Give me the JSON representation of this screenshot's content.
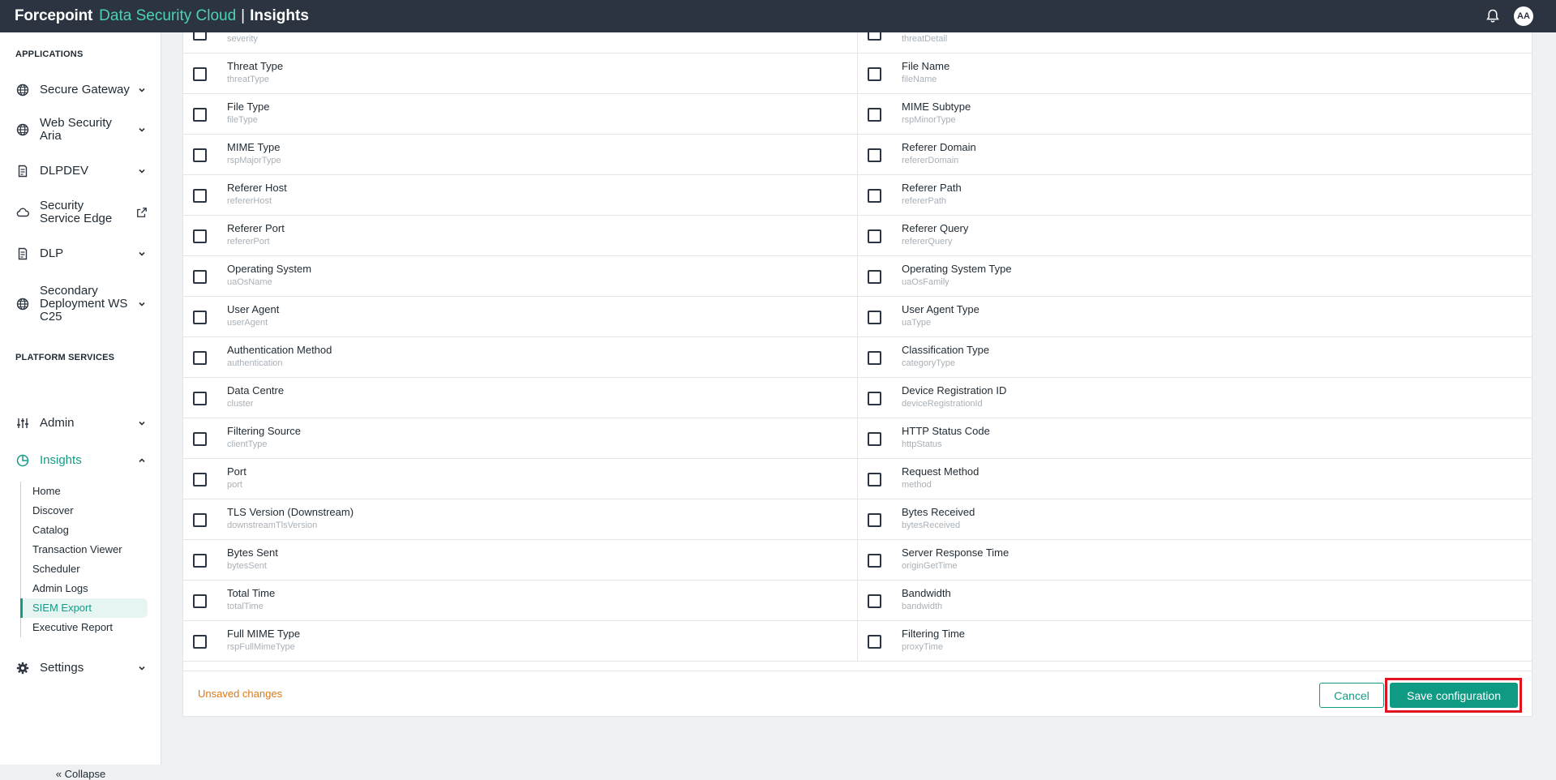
{
  "header": {
    "brand": "Forcepoint",
    "product": "Data Security Cloud",
    "separator": "|",
    "app": "Insights",
    "avatar_initials": "AA"
  },
  "sidebar": {
    "applications_heading": "APPLICATIONS",
    "applications": [
      {
        "label": "Secure Gateway",
        "icon": "globe-icon"
      },
      {
        "label": "Web Security Aria",
        "icon": "globe-icon"
      },
      {
        "label": "DLPDEV",
        "icon": "document-icon"
      },
      {
        "label": "Security Service Edge",
        "icon": "cloud-icon"
      },
      {
        "label": "DLP",
        "icon": "document-icon"
      },
      {
        "label": "Secondary Deployment WS C25",
        "icon": "globe-icon"
      }
    ],
    "platform_heading": "PLATFORM SERVICES",
    "admin_label": "Admin",
    "insights_label": "Insights",
    "insights_subitems": [
      "Home",
      "Discover",
      "Catalog",
      "Transaction Viewer",
      "Scheduler",
      "Admin Logs",
      "SIEM Export",
      "Executive Report"
    ],
    "active_subitem": "SIEM Export",
    "settings_label": "Settings",
    "collapse_label": "Collapse"
  },
  "fields": {
    "partial_row": {
      "left_key": "severity",
      "right_key": "threatDetail"
    },
    "rows": [
      {
        "left": {
          "label": "Threat Type",
          "key": "threatType"
        },
        "right": {
          "label": "File Name",
          "key": "fileName"
        }
      },
      {
        "left": {
          "label": "File Type",
          "key": "fileType"
        },
        "right": {
          "label": "MIME Subtype",
          "key": "rspMinorType"
        }
      },
      {
        "left": {
          "label": "MIME Type",
          "key": "rspMajorType"
        },
        "right": {
          "label": "Referer Domain",
          "key": "refererDomain"
        }
      },
      {
        "left": {
          "label": "Referer Host",
          "key": "refererHost"
        },
        "right": {
          "label": "Referer Path",
          "key": "refererPath"
        }
      },
      {
        "left": {
          "label": "Referer Port",
          "key": "refererPort"
        },
        "right": {
          "label": "Referer Query",
          "key": "refererQuery"
        }
      },
      {
        "left": {
          "label": "Operating System",
          "key": "uaOsName"
        },
        "right": {
          "label": "Operating System Type",
          "key": "uaOsFamily"
        }
      },
      {
        "left": {
          "label": "User Agent",
          "key": "userAgent"
        },
        "right": {
          "label": "User Agent Type",
          "key": "uaType"
        }
      },
      {
        "left": {
          "label": "Authentication Method",
          "key": "authentication"
        },
        "right": {
          "label": "Classification Type",
          "key": "categoryType"
        }
      },
      {
        "left": {
          "label": "Data Centre",
          "key": "cluster"
        },
        "right": {
          "label": "Device Registration ID",
          "key": "deviceRegistrationId"
        }
      },
      {
        "left": {
          "label": "Filtering Source",
          "key": "clientType"
        },
        "right": {
          "label": "HTTP Status Code",
          "key": "httpStatus"
        }
      },
      {
        "left": {
          "label": "Port",
          "key": "port"
        },
        "right": {
          "label": "Request Method",
          "key": "method"
        }
      },
      {
        "left": {
          "label": "TLS Version (Downstream)",
          "key": "downstreamTlsVersion"
        },
        "right": {
          "label": "Bytes Received",
          "key": "bytesReceived"
        }
      },
      {
        "left": {
          "label": "Bytes Sent",
          "key": "bytesSent"
        },
        "right": {
          "label": "Server Response Time",
          "key": "originGetTime"
        }
      },
      {
        "left": {
          "label": "Total Time",
          "key": "totalTime"
        },
        "right": {
          "label": "Bandwidth",
          "key": "bandwidth"
        }
      },
      {
        "left": {
          "label": "Full MIME Type",
          "key": "rspFullMimeType"
        },
        "right": {
          "label": "Filtering Time",
          "key": "proxyTime"
        }
      }
    ]
  },
  "footer": {
    "unsaved_text": "Unsaved changes",
    "cancel_label": "Cancel",
    "save_label": "Save configuration"
  },
  "colors": {
    "accent": "#149b85",
    "topbar": "#2b3440",
    "warning": "#d97a1a",
    "highlight": "#e0141e"
  }
}
